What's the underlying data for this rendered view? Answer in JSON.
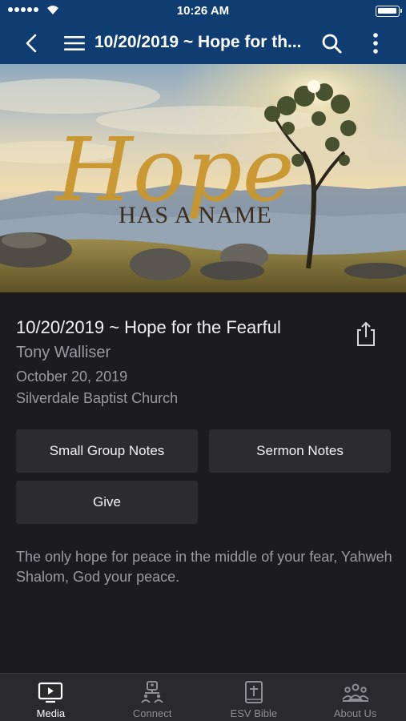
{
  "status_bar": {
    "time": "10:26 AM"
  },
  "nav_bar": {
    "title": "10/20/2019 ~ Hope for th..."
  },
  "hero": {
    "title_script": "Hope",
    "title_caps": "HAS A NAME"
  },
  "details": {
    "title": "10/20/2019 ~ Hope for the Fearful",
    "speaker": "Tony Walliser",
    "date": "October 20, 2019",
    "church": "Silverdale Baptist Church"
  },
  "actions": {
    "small_group_notes": "Small Group Notes",
    "sermon_notes": "Sermon Notes",
    "give": "Give"
  },
  "description": "The only hope for peace in the middle of your fear, Yahweh Shalom, God your peace.",
  "tabs": [
    {
      "label": "Media",
      "icon": "tv-icon",
      "active": true
    },
    {
      "label": "Connect",
      "icon": "people-connect-icon",
      "active": false
    },
    {
      "label": "ESV Bible",
      "icon": "bible-icon",
      "active": false
    },
    {
      "label": "About Us",
      "icon": "group-icon",
      "active": false
    }
  ],
  "colors": {
    "nav_bar": "#0f3d72",
    "background": "#1c1c1e",
    "button": "#2c2c2e",
    "tab_bar": "#2a2a2c",
    "hero_script": "#c9962e"
  }
}
